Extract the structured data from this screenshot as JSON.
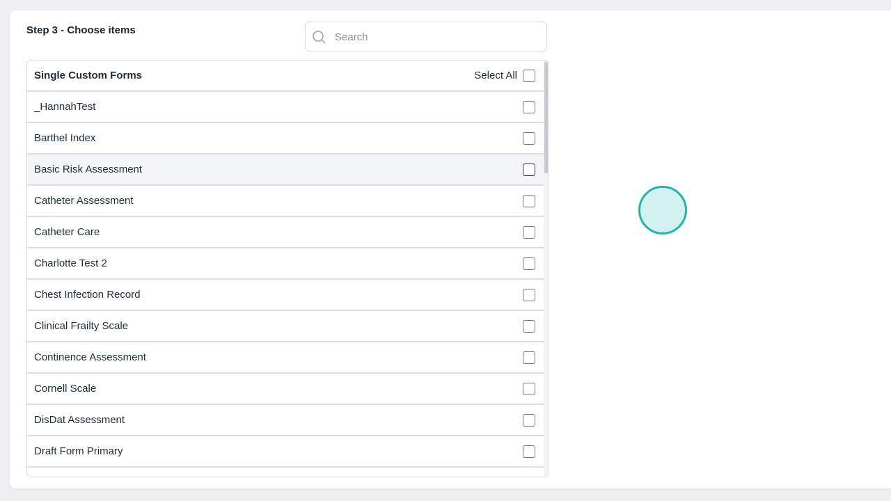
{
  "page": {
    "title": "Step 3 - Choose items"
  },
  "search": {
    "placeholder": "Search",
    "value": ""
  },
  "list": {
    "header": "Single Custom Forms",
    "select_all_label": "Select All",
    "items": [
      {
        "label": "_HannahTest",
        "checked": false
      },
      {
        "label": "Barthel Index",
        "checked": false
      },
      {
        "label": "Basic Risk Assessment",
        "checked": false,
        "hovered": true
      },
      {
        "label": "Catheter Assessment",
        "checked": false
      },
      {
        "label": "Catheter Care",
        "checked": false
      },
      {
        "label": "Charlotte Test 2",
        "checked": false
      },
      {
        "label": "Chest Infection Record",
        "checked": false
      },
      {
        "label": "Clinical Frailty Scale",
        "checked": false
      },
      {
        "label": "Continence Assessment",
        "checked": false
      },
      {
        "label": "Cornell Scale",
        "checked": false
      },
      {
        "label": "DisDat Assessment",
        "checked": false
      },
      {
        "label": "Draft Form Primary",
        "checked": false
      }
    ]
  },
  "colors": {
    "accent": "#1fb5a9",
    "text": "#1d2d3c"
  }
}
